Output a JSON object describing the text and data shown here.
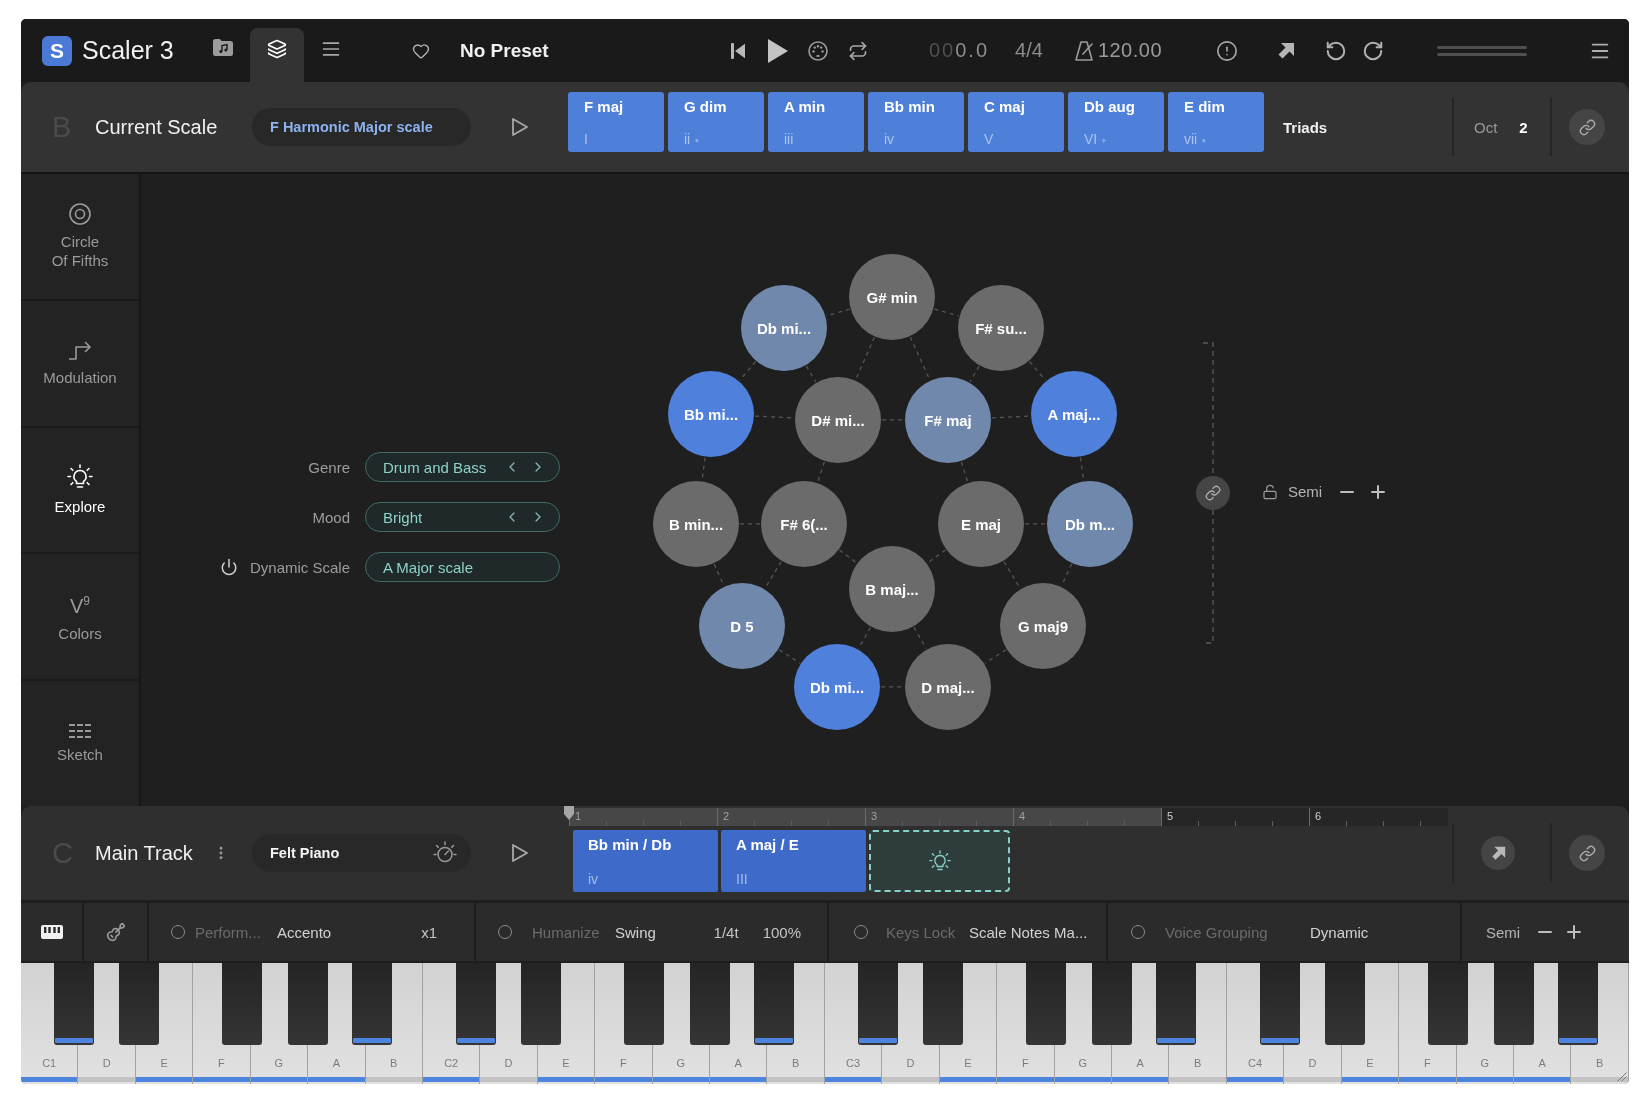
{
  "app": {
    "logo": "S",
    "name": "Scaler 3"
  },
  "view_tabs": [
    {
      "selected": false
    },
    {
      "selected": true
    },
    {
      "selected": false
    }
  ],
  "preset": {
    "favorite": false,
    "name": "No Preset"
  },
  "transport": {
    "position": {
      "dim": "00",
      "lit": "0.0"
    },
    "time_signature": "4/4",
    "tempo": "120.00"
  },
  "scale_bar": {
    "section": "B",
    "title": "Current Scale",
    "scale": "F Harmonic Major scale",
    "chords": [
      {
        "name": "F maj",
        "degree": "I"
      },
      {
        "name": "G dim",
        "degree": "ii $_{∘}$"
      },
      {
        "name": "A min",
        "degree": "iii"
      },
      {
        "name": "Bb min",
        "degree": "iv"
      },
      {
        "name": "C maj",
        "degree": "V"
      },
      {
        "name": "Db aug",
        "degree": "VI $_{+}$"
      },
      {
        "name": "E dim",
        "degree": "vii $_{∘}$"
      }
    ],
    "voicing": "Triads",
    "octave_label": "Oct",
    "octave": "2"
  },
  "sidebar": [
    {
      "label": "Circle Of Fifths",
      "selected": false
    },
    {
      "label": "Modulation",
      "selected": false
    },
    {
      "label": "Explore",
      "selected": true
    },
    {
      "label": "Colors",
      "selected": false,
      "glyph": "V$^{9}$"
    },
    {
      "label": "Sketch",
      "selected": false
    }
  ],
  "explore": {
    "fields": [
      {
        "kind": "stepper",
        "label": "Genre",
        "value": "Drum and Bass"
      },
      {
        "kind": "stepper",
        "label": "Mood",
        "value": "Bright"
      },
      {
        "kind": "toggle",
        "label": "Dynamic Scale",
        "value": "A Major scale"
      }
    ]
  },
  "chord_graph": {
    "nodes": [
      {
        "label": "G# min",
        "color": "#6b6b6b"
      },
      {
        "label": "Db mi...",
        "color": "#7088ab"
      },
      {
        "label": "F# su...",
        "color": "#6b6b6b"
      },
      {
        "label": "Bb mi...",
        "color": "#4f80dc"
      },
      {
        "label": "D# mi...",
        "color": "#6b6b6b"
      },
      {
        "label": "F# maj",
        "color": "#7088ab"
      },
      {
        "label": "A maj...",
        "color": "#4f80dc"
      },
      {
        "label": "B min...",
        "color": "#6b6b6b"
      },
      {
        "label": "F# 6(...",
        "color": "#6b6b6b"
      },
      {
        "label": "E maj",
        "color": "#6b6b6b"
      },
      {
        "label": "Db m...",
        "color": "#7088ab"
      },
      {
        "label": "B maj...",
        "color": "#6b6b6b"
      },
      {
        "label": "D 5",
        "color": "#7088ab"
      },
      {
        "label": "G maj9",
        "color": "#6b6b6b"
      },
      {
        "label": "Db mi...",
        "color": "#4f80dc"
      },
      {
        "label": "D maj...",
        "color": "#6b6b6b"
      }
    ]
  },
  "transpose": {
    "label": "Semi"
  },
  "track": {
    "section": "C",
    "title": "Main Track",
    "instrument": "Felt Piano",
    "ruler": [
      {
        "label": "1",
        "filled": true
      },
      {
        "label": "2",
        "filled": true
      },
      {
        "label": "3",
        "filled": true
      },
      {
        "label": "4",
        "filled": true
      },
      {
        "label": "5",
        "filled": false
      },
      {
        "label": "6",
        "filled": false
      }
    ],
    "clips": [
      {
        "kind": "chord",
        "chord": "Bb min / Db",
        "degree": "iv"
      },
      {
        "kind": "chord",
        "chord": "A maj / E",
        "degree": "III"
      },
      {
        "kind": "suggestion"
      }
    ]
  },
  "performance_bar": {
    "view_toggles": [
      {
        "selected": true
      },
      {
        "selected": false
      }
    ],
    "options": [
      {
        "on": false,
        "label": "Perform...",
        "value": "Accento",
        "extras": [
          "x1"
        ]
      },
      {
        "on": false,
        "label": "Humanize",
        "value": "Swing",
        "extras": [
          "1/4t",
          "100%"
        ]
      },
      {
        "on": false,
        "label": "Keys Lock",
        "value": "Scale Notes Ma..."
      },
      {
        "on": false,
        "label": "Voice Grouping",
        "value": "Dynamic"
      }
    ],
    "transpose_label": "Semi"
  },
  "keyboard": {
    "white_keys": [
      {
        "label": "C1",
        "highlighted": true
      },
      {
        "label": "D",
        "highlighted": false
      },
      {
        "label": "E",
        "highlighted": true
      },
      {
        "label": "F",
        "highlighted": true
      },
      {
        "label": "G",
        "highlighted": true
      },
      {
        "label": "A",
        "highlighted": true
      },
      {
        "label": "B",
        "highlighted": false
      },
      {
        "label": "C2",
        "highlighted": true
      },
      {
        "label": "D",
        "highlighted": false
      },
      {
        "label": "E",
        "highlighted": true
      },
      {
        "label": "F",
        "highlighted": true
      },
      {
        "label": "G",
        "highlighted": true
      },
      {
        "label": "A",
        "highlighted": true
      },
      {
        "label": "B",
        "highlighted": false
      },
      {
        "label": "C3",
        "highlighted": true
      },
      {
        "label": "D",
        "highlighted": false
      },
      {
        "label": "E",
        "highlighted": true
      },
      {
        "label": "F",
        "highlighted": true
      },
      {
        "label": "G",
        "highlighted": true
      },
      {
        "label": "A",
        "highlighted": true
      },
      {
        "label": "B",
        "highlighted": false
      },
      {
        "label": "C4",
        "highlighted": true
      },
      {
        "label": "D",
        "highlighted": false
      },
      {
        "label": "E",
        "highlighted": true
      },
      {
        "label": "F",
        "highlighted": true
      },
      {
        "label": "G",
        "highlighted": true
      },
      {
        "label": "A",
        "highlighted": true
      },
      {
        "label": "B",
        "highlighted": false
      }
    ],
    "black_keys": [
      {
        "highlighted": true
      },
      {
        "highlighted": false
      },
      {
        "highlighted": false
      },
      {
        "highlighted": false
      },
      {
        "highlighted": true
      },
      {
        "highlighted": true
      },
      {
        "highlighted": false
      },
      {
        "highlighted": false
      },
      {
        "highlighted": false
      },
      {
        "highlighted": true
      },
      {
        "highlighted": true
      },
      {
        "highlighted": false
      },
      {
        "highlighted": false
      },
      {
        "highlighted": false
      },
      {
        "highlighted": true
      },
      {
        "highlighted": true
      },
      {
        "highlighted": false
      },
      {
        "highlighted": false
      },
      {
        "highlighted": false
      },
      {
        "highlighted": true
      }
    ]
  }
}
